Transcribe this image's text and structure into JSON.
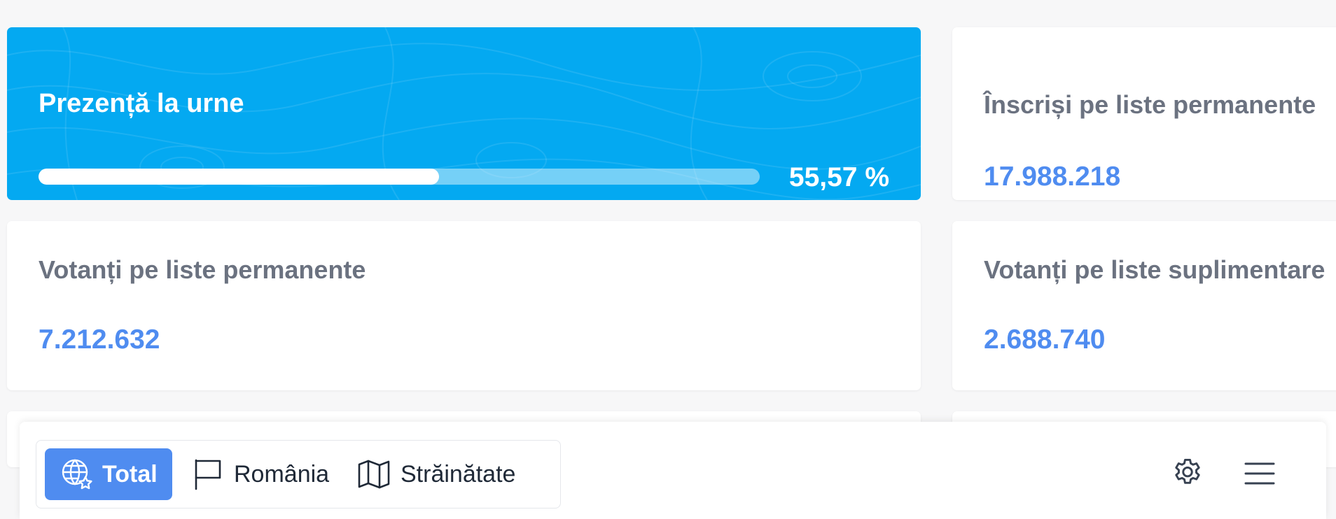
{
  "turnout": {
    "title": "Prezență la urne",
    "percent_label": "55,57 %",
    "progress_fraction": 0.5557
  },
  "registered": {
    "title": "Înscriși pe liste permanente",
    "value": "17.988.218"
  },
  "voters_permanent": {
    "title": "Votanți pe liste permanente",
    "value": "7.212.632"
  },
  "voters_supplementary": {
    "title": "Votanți pe liste suplimentare",
    "value": "2.688.740"
  },
  "nav": {
    "tabs": [
      {
        "label": "Total",
        "icon": "globe-star-icon",
        "active": true
      },
      {
        "label": "România",
        "icon": "flag-icon",
        "active": false
      },
      {
        "label": "Străinătate",
        "icon": "map-icon",
        "active": false
      }
    ],
    "settings_icon": "gear-icon",
    "menu_icon": "hamburger-menu-icon"
  },
  "colors": {
    "turnout_bg": "#04a9f1",
    "accent_blue": "#4f8cf0",
    "title_gray": "#6b7280",
    "page_bg": "#f7f7f8"
  }
}
